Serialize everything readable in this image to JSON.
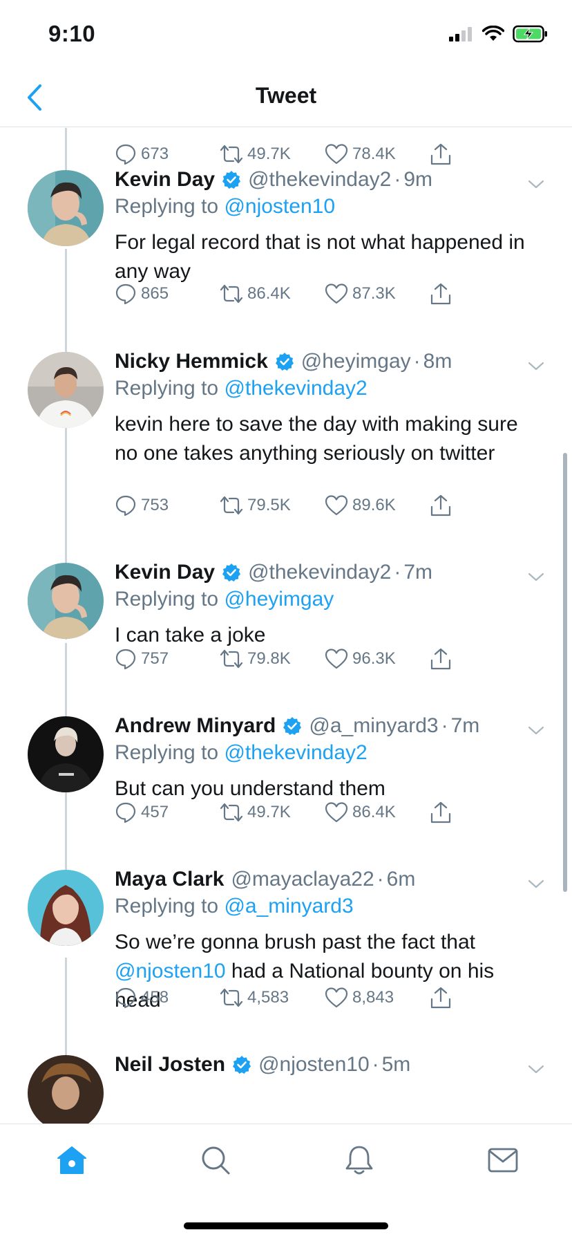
{
  "status": {
    "time": "9:10"
  },
  "header": {
    "title": "Tweet"
  },
  "top_actions": {
    "replies": "673",
    "retweets": "49.7K",
    "likes": "78.4K"
  },
  "tweets": [
    {
      "name": "Kevin Day",
      "verified": true,
      "handle": "@thekevinday2",
      "time": "9m",
      "replying_prefix": "Replying to",
      "replying_to": "@njosten10",
      "text": "For legal record that is not what happened in any way",
      "replies": "865",
      "retweets": "86.4K",
      "likes": "87.3K"
    },
    {
      "name": "Nicky Hemmick",
      "verified": true,
      "handle": "@heyimgay",
      "time": "8m",
      "replying_prefix": "Replying to",
      "replying_to": "@thekevinday2",
      "text": "kevin here to save the day with making sure no one takes anything seriously on twitter",
      "replies": "753",
      "retweets": "79.5K",
      "likes": "89.6K"
    },
    {
      "name": "Kevin Day",
      "verified": true,
      "handle": "@thekevinday2",
      "time": "7m",
      "replying_prefix": "Replying to",
      "replying_to": "@heyimgay",
      "text": "I can take a joke",
      "replies": "757",
      "retweets": "79.8K",
      "likes": "96.3K"
    },
    {
      "name": "Andrew Minyard",
      "verified": true,
      "handle": "@a_minyard3",
      "time": "7m",
      "replying_prefix": "Replying to",
      "replying_to": "@thekevinday2",
      "text": "But can you understand them",
      "replies": "457",
      "retweets": "49.7K",
      "likes": "86.4K"
    },
    {
      "name": "Maya Clark",
      "verified": false,
      "handle": "@mayaclaya22",
      "time": "6m",
      "replying_prefix": "Replying to",
      "replying_to": "@a_minyard3",
      "text_before": "So we’re gonna brush past the fact that",
      "text_mention": "@njosten10",
      "text_after": "had a National bounty on his head",
      "replies": "458",
      "retweets": "4,583",
      "likes": "8,843"
    },
    {
      "name": "Neil Josten",
      "verified": true,
      "handle": "@njosten10",
      "time": "5m"
    }
  ],
  "icons": {
    "back": "chevron-left-icon",
    "reply": "speech-bubble-icon",
    "retweet": "retweet-arrows-icon",
    "like": "heart-icon",
    "share": "share-up-icon",
    "verified": "verified-badge-icon",
    "caret": "chevron-down-icon",
    "tabs": [
      "home-icon",
      "search-icon",
      "bell-icon",
      "envelope-icon"
    ]
  },
  "colors": {
    "accent": "#1da1f2",
    "muted": "#657786",
    "battery": "#4cd964"
  }
}
